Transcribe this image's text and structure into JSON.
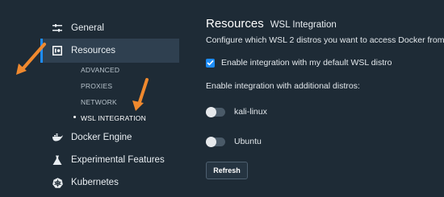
{
  "sidebar": {
    "items": [
      {
        "label": "General",
        "icon": "sliders-icon"
      },
      {
        "label": "Resources",
        "icon": "resources-icon"
      },
      {
        "label": "Docker Engine",
        "icon": "whale-icon"
      },
      {
        "label": "Experimental Features",
        "icon": "flask-icon"
      },
      {
        "label": "Kubernetes",
        "icon": "helm-wheel-icon"
      }
    ],
    "sub_items": [
      "ADVANCED",
      "PROXIES",
      "NETWORK",
      "WSL INTEGRATION"
    ]
  },
  "main": {
    "title": "Resources",
    "subtitle": "WSL Integration",
    "description": "Configure which WSL 2 distros you want to access Docker from.",
    "default_checkbox_label": "Enable integration with my default WSL distro",
    "default_checked": true,
    "additional_label": "Enable integration with additional distros:",
    "distros": [
      {
        "name": "kali-linux",
        "enabled": false
      },
      {
        "name": "Ubuntu",
        "enabled": false
      }
    ],
    "refresh_label": "Refresh"
  },
  "colors": {
    "background": "#1e2b36",
    "accent": "#1d8cf8",
    "annotation_arrow": "#f0892e"
  }
}
